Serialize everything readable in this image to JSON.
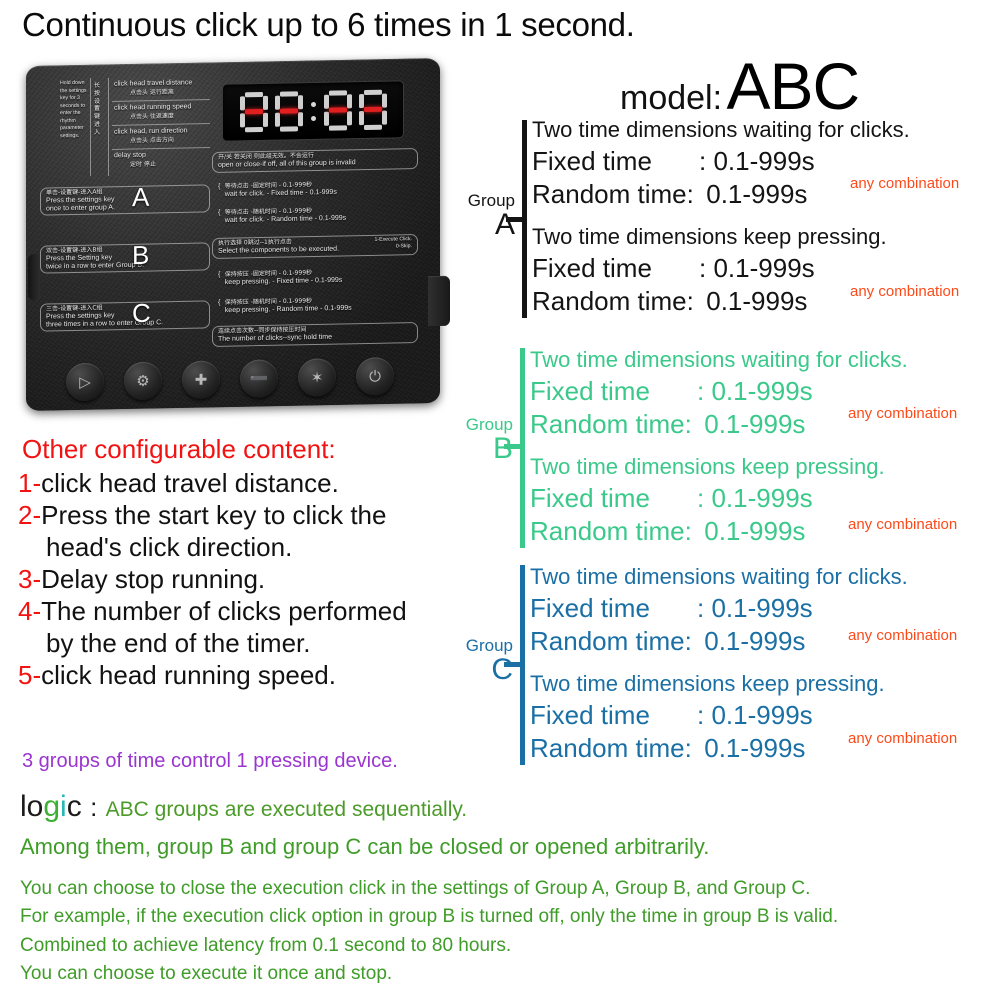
{
  "headline": "Continuous click up to 6 times in 1 second.",
  "model": {
    "label": "model:",
    "value": "ABC"
  },
  "device": {
    "display": {
      "digits": [
        "8",
        "8",
        "8",
        "8"
      ],
      "separator": ":"
    },
    "left_column_note_en": "Hold down the settings key for 3 seconds to enter the rhythm parameter settings.",
    "left_column_note_cn": "长按设置键进入",
    "features": [
      {
        "en": "click head travel distance",
        "cn": "点击头 运行距离"
      },
      {
        "en": "click head running speed",
        "cn": "点击头 往返速度"
      },
      {
        "en": "click head, run direction",
        "cn": "点击头 点击方向"
      },
      {
        "en": "delay stop",
        "cn": "定时 停止"
      }
    ],
    "groups": [
      {
        "letter": "A",
        "cn": "单击-设置键-进入A组",
        "en1": "Press the settings key",
        "en2": "once to enter group A."
      },
      {
        "letter": "B",
        "cn": "双击-设置键-进入B组",
        "en1": "Press the Setting key",
        "en2": "twice in a row to enter Group B."
      },
      {
        "letter": "C",
        "cn": "三击-设置键-进入C组",
        "en1": "Press the settings key",
        "en2": "three times in a row to enter Group C."
      }
    ],
    "right_panel": {
      "toggle_cn": "开/关 若关闭 则此组无效。不会运行",
      "toggle_en": "open or close-if off, all of this group is invalid",
      "rows": [
        {
          "cn": "等待点击 -固定时间 - 0.1-999秒",
          "en": "wait for click.  -  Fixed time  -  0.1-999s"
        },
        {
          "cn": "等待点击 -随机时间 - 0.1-999秒",
          "en": "wait for click.  -  Random time  -  0.1-999s"
        }
      ],
      "select_cn": "执行选择  0跳过--1执行点击",
      "select_cn_right": "1-Execute Click.",
      "select_en": "Select the components to be executed.",
      "select_en_right": "0-Skip.",
      "rows2": [
        {
          "cn": "保持按压 -固定时间 - 0.1-999秒",
          "en": "keep pressing.  -  Fixed time  -  0.1-999s"
        },
        {
          "cn": "保持按压 -随机时间 - 0.1-999秒",
          "en": "keep pressing.  -  Random time  -  0.1-999s"
        }
      ],
      "footer_cn": "连续点击次数--同步保持按压时间",
      "footer_en": "The number of clicks--sync hold time"
    },
    "buttons": [
      {
        "name": "play-button",
        "glyph": "▷"
      },
      {
        "name": "settings-gear-button",
        "glyph": "⚙"
      },
      {
        "name": "plus-button",
        "glyph": "✚"
      },
      {
        "name": "minus-button",
        "glyph": "➖"
      },
      {
        "name": "star-button",
        "glyph": "✶"
      },
      {
        "name": "power-button",
        "glyph": "⏻"
      }
    ]
  },
  "groups": [
    {
      "id": "A",
      "color": "#141414",
      "word": "Group",
      "letter": "A",
      "blocks": [
        {
          "heading": "Two time dimensions waiting for clicks.",
          "rows": [
            {
              "label": "Fixed time",
              "sep": ":",
              "value": "0.1-999s"
            },
            {
              "label": "Random time:",
              "sep": "",
              "value": "0.1-999s"
            }
          ],
          "note": "any combination"
        },
        {
          "heading": "Two time dimensions keep pressing.",
          "rows": [
            {
              "label": "Fixed time",
              "sep": ":",
              "value": "0.1-999s"
            },
            {
              "label": "Random time:",
              "sep": "",
              "value": "0.1-999s"
            }
          ],
          "note": "any combination"
        }
      ]
    },
    {
      "id": "B",
      "color": "#3ac98a",
      "word": "Group",
      "letter": "B",
      "blocks": [
        {
          "heading": "Two time dimensions waiting for clicks.",
          "rows": [
            {
              "label": "Fixed time",
              "sep": ":",
              "value": "0.1-999s"
            },
            {
              "label": "Random time:",
              "sep": "",
              "value": "0.1-999s"
            }
          ],
          "note": "any combination"
        },
        {
          "heading": "Two time dimensions keep pressing.",
          "rows": [
            {
              "label": "Fixed time",
              "sep": ":",
              "value": "0.1-999s"
            },
            {
              "label": "Random time:",
              "sep": "",
              "value": "0.1-999s"
            }
          ],
          "note": "any combination"
        }
      ]
    },
    {
      "id": "C",
      "color": "#1a6fa5",
      "word": "Group",
      "letter": "C",
      "blocks": [
        {
          "heading": "Two time dimensions waiting for clicks.",
          "rows": [
            {
              "label": "Fixed time",
              "sep": ":",
              "value": "0.1-999s"
            },
            {
              "label": "Random time:",
              "sep": "",
              "value": "0.1-999s"
            }
          ],
          "note": "any combination"
        },
        {
          "heading": "Two time dimensions keep pressing.",
          "rows": [
            {
              "label": "Fixed time",
              "sep": ":",
              "value": "0.1-999s"
            },
            {
              "label": "Random time:",
              "sep": "",
              "value": "0.1-999s"
            }
          ],
          "note": "any combination"
        }
      ]
    }
  ],
  "other": {
    "title": "Other configurable content:",
    "items": [
      {
        "n": "1-",
        "text": "click head travel distance.",
        "cont": ""
      },
      {
        "n": "2-",
        "text": "Press the start key to click the",
        "cont": "head's click direction."
      },
      {
        "n": "3-",
        "text": "Delay stop running.",
        "cont": ""
      },
      {
        "n": "4-",
        "text": "The number of clicks performed",
        "cont": "by the end of the timer."
      },
      {
        "n": "5-",
        "text": "click head running speed.",
        "cont": ""
      }
    ],
    "purple_line": "3 groups of time control 1 pressing device."
  },
  "logic": {
    "word_parts": [
      "lo",
      "g",
      "i",
      "c"
    ],
    "colon": ":",
    "lead": "ABC groups are executed sequentially.",
    "lines_big": [
      "Among them, group B and group C can be closed or opened arbitrarily."
    ],
    "lines_small": [
      "You can choose to close the execution click in the settings of Group A, Group B, and Group C.",
      "For example, if the execution click option in group B is turned off, only the time in group B is valid.",
      "Combined to achieve latency from 0.1 second to 80 hours.",
      "You can choose to execute it once and stop."
    ]
  },
  "colors": {
    "red": "#f21212",
    "orange_note": "#fc4a1a",
    "green_group": "#3ac98a",
    "blue_group": "#1a6fa5",
    "purple": "#9a35cf",
    "green_text": "#3f9c29",
    "teal": "#27b7b7"
  }
}
